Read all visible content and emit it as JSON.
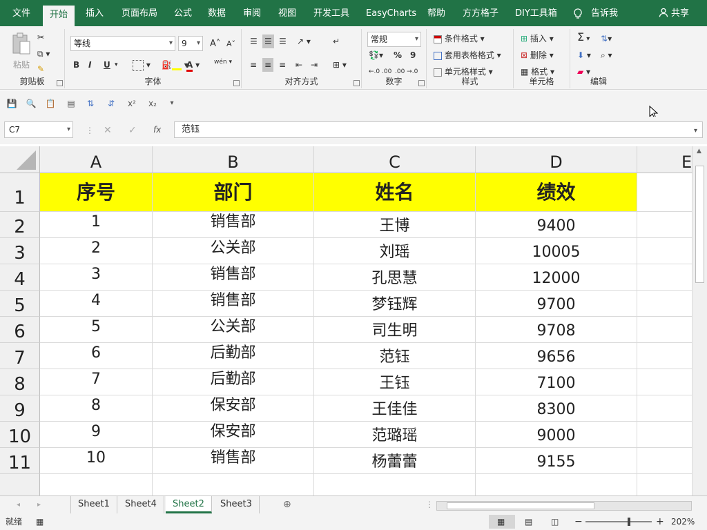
{
  "ribbon_tabs": [
    "文件",
    "开始",
    "插入",
    "页面布局",
    "公式",
    "数据",
    "审阅",
    "视图",
    "开发工具",
    "EasyCharts",
    "帮助",
    "方方格子",
    "DIY工具箱",
    "告诉我"
  ],
  "share_label": "共享",
  "clipboard": {
    "paste": "粘贴",
    "label": "剪贴板"
  },
  "font": {
    "name": "等线",
    "size": "9",
    "label": "字体",
    "bold": "B",
    "italic": "I",
    "underline": "U",
    "font_color_icon": "A",
    "grow": "A",
    "shrink": "A",
    "phonetic": "wén"
  },
  "alignment": {
    "label": "对齐方式"
  },
  "number": {
    "format": "常规",
    "label": "数字",
    "percent": "%",
    "comma": "9",
    "inc": "←.0 .00",
    "dec": ".00 →.0"
  },
  "styles": {
    "conditional": "条件格式",
    "table": "套用表格格式",
    "cell": "单元格样式",
    "label": "样式"
  },
  "cells": {
    "insert": "插入",
    "delete": "删除",
    "format": "格式",
    "label": "单元格"
  },
  "editing": {
    "label": "编辑"
  },
  "name_box": "C7",
  "formula_value": "范钰",
  "fx_label": "fx",
  "columns": [
    "A",
    "B",
    "C",
    "D",
    "E"
  ],
  "rows": [
    "1",
    "2",
    "3",
    "4",
    "5",
    "6",
    "7",
    "8",
    "9",
    "10",
    "11"
  ],
  "table": {
    "headers": [
      "序号",
      "部门",
      "姓名",
      "绩效"
    ],
    "data": [
      [
        "1",
        "销售部",
        "王博",
        "9400"
      ],
      [
        "2",
        "公关部",
        "刘瑶",
        "10005"
      ],
      [
        "3",
        "销售部",
        "孔思慧",
        "12000"
      ],
      [
        "4",
        "销售部",
        "梦钰辉",
        "9700"
      ],
      [
        "5",
        "公关部",
        "司生明",
        "9708"
      ],
      [
        "6",
        "后勤部",
        "范钰",
        "9656"
      ],
      [
        "7",
        "后勤部",
        "王钰",
        "7100"
      ],
      [
        "8",
        "保安部",
        "王佳佳",
        "8300"
      ],
      [
        "9",
        "保安部",
        "范璐瑶",
        "9000"
      ],
      [
        "10",
        "销售部",
        "杨蕾蕾",
        "9155"
      ]
    ]
  },
  "sheets": [
    "Sheet1",
    "Sheet4",
    "Sheet2",
    "Sheet3"
  ],
  "active_sheet": "Sheet2",
  "status_text": "就绪",
  "zoom": "202%",
  "colors": {
    "brand": "#217346",
    "header_fill": "#ffff00"
  }
}
